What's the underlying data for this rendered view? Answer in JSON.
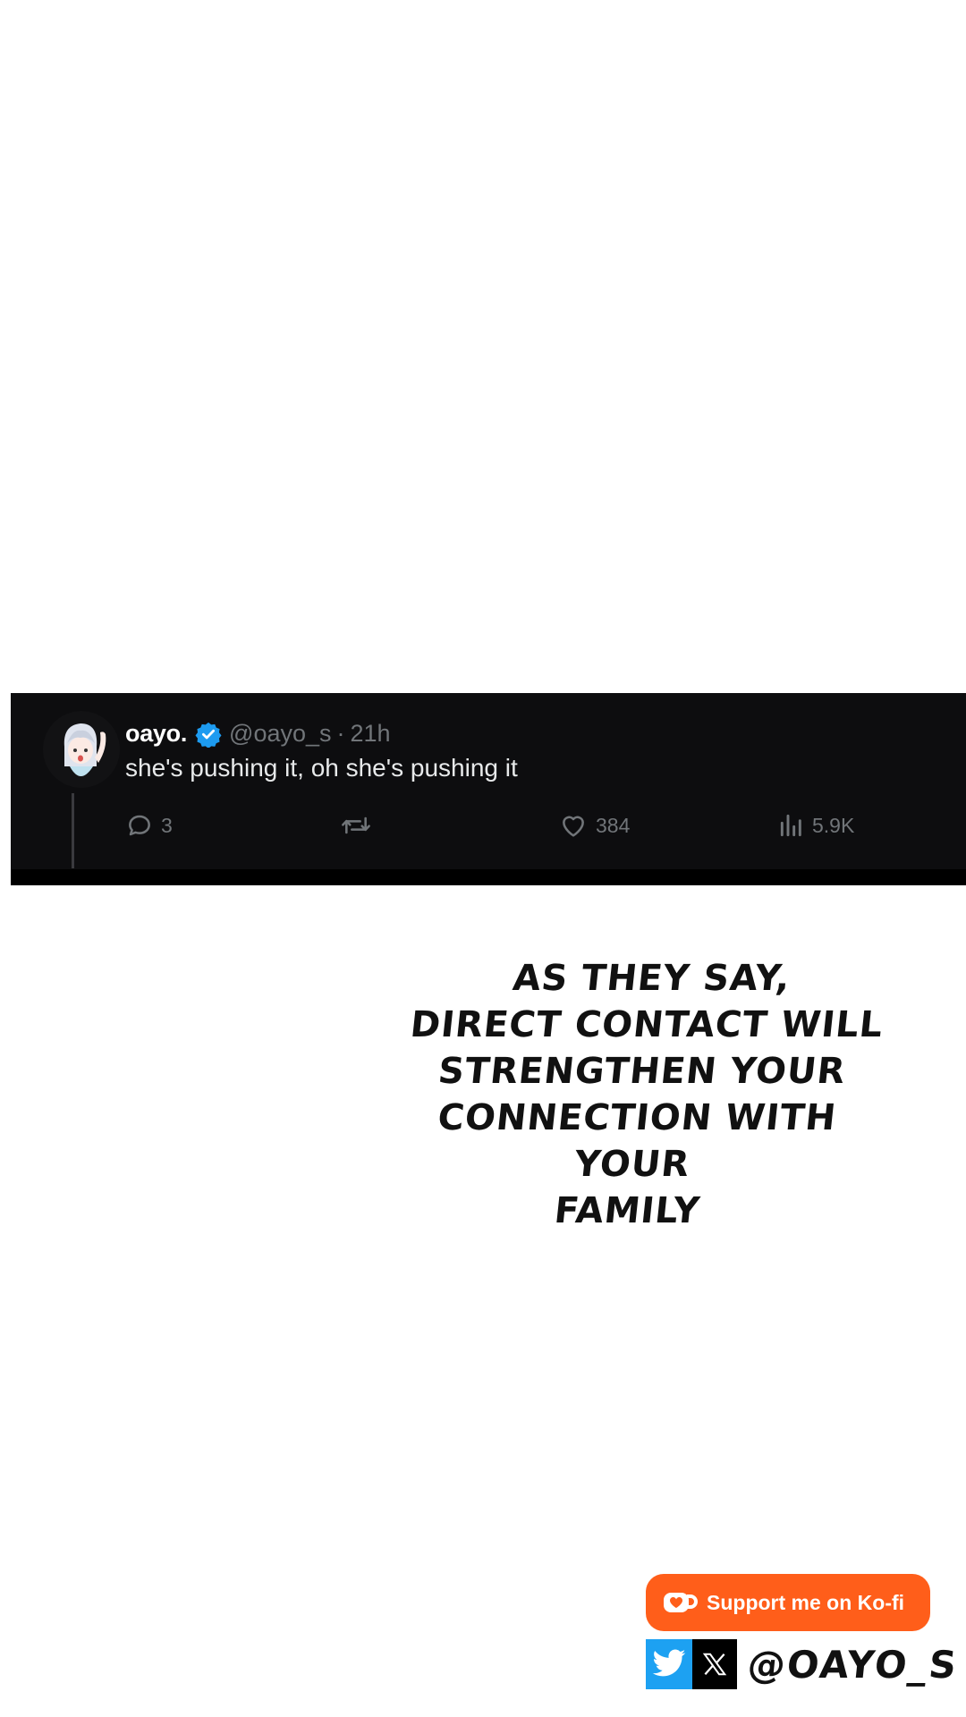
{
  "tweet": {
    "display_name": "oayo.",
    "handle": "@oayo_s",
    "separator": "·",
    "time": "21h",
    "text": "she's pushing it, oh she's pushing it",
    "actions": {
      "replies": "3",
      "likes": "384",
      "views": "5.9K"
    },
    "icons": [
      "avatar",
      "verified-badge-icon",
      "reply-icon",
      "retweet-icon",
      "like-icon",
      "views-icon"
    ],
    "colors": {
      "card_background": "#0d0d0f",
      "verified": "#1d9bf0",
      "muted_text": "#717579"
    }
  },
  "caption": {
    "lines": [
      "AS THEY SAY,",
      "DIRECT CONTACT WILL",
      "STRENGTHEN YOUR",
      "CONNECTION WITH YOUR",
      "FAMILY"
    ]
  },
  "kofi": {
    "label": "Support me on Ko-fi",
    "color": "#ff5e1a"
  },
  "social": {
    "handle": "@OAYO_S",
    "icons": [
      "twitter-bird-icon",
      "x-logo-icon"
    ],
    "colors": {
      "twitter": "#1da1f2",
      "x": "#000000"
    }
  }
}
